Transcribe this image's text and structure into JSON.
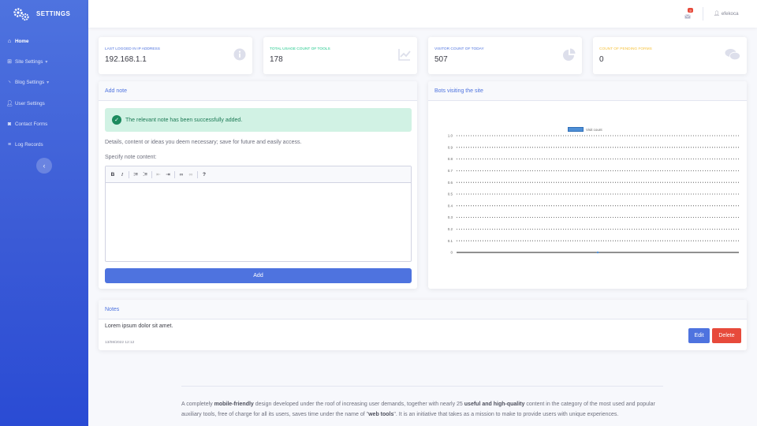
{
  "brand": {
    "title": "SETTINGS"
  },
  "sidebar": {
    "items": [
      {
        "label": "Home",
        "icon": "home-icon",
        "active": true
      },
      {
        "label": "Site Settings",
        "icon": "sitemap-icon",
        "caret": true
      },
      {
        "label": "Blog Settings",
        "icon": "rss-icon",
        "caret": true
      },
      {
        "label": "User Settings",
        "icon": "user-icon"
      },
      {
        "label": "Contact Forms",
        "icon": "comments-icon"
      },
      {
        "label": "Log Records",
        "icon": "database-icon"
      }
    ],
    "toggle_icon": "chevron-left-icon"
  },
  "topbar": {
    "notification_count": "9",
    "username": "efekoca"
  },
  "stats": [
    {
      "label": "LAST LOGGED IN IP ADDRESS",
      "value": "192.168.1.1",
      "icon": "info-circle-icon",
      "color": "#4e73df"
    },
    {
      "label": "TOTAL USAGE COUNT OF TOOLS",
      "value": "178",
      "icon": "chart-line-icon",
      "color": "#1cc88a"
    },
    {
      "label": "VISITOR COUNT OF TODAY",
      "value": "507",
      "icon": "chart-pie-icon",
      "color": "#4e73df"
    },
    {
      "label": "COUNT OF PENDING FORMS",
      "value": "0",
      "icon": "comments-icon",
      "color": "#f6c23e"
    }
  ],
  "add_note": {
    "title": "Add note",
    "alert": "The relevant note has been successfully added.",
    "description": "Details, content or ideas you deem necessary; save for future and easily access.",
    "field_label": "Specify note content:",
    "toolbar": [
      "B",
      "I",
      "ol",
      "ul",
      "outdent",
      "indent",
      "link",
      "unlink",
      "?"
    ],
    "button": "Add"
  },
  "bots": {
    "title": "Bots visiting the site",
    "chart_data": {
      "type": "line",
      "series": [
        {
          "name": "Visit count",
          "values": [
            0
          ]
        }
      ],
      "yticks": [
        "1.0",
        "0.9",
        "0.8",
        "0.7",
        "0.6",
        "0.5",
        "0.4",
        "0.3",
        "0.2",
        "0.1",
        "0"
      ],
      "ylim": [
        0,
        1
      ],
      "grid": true,
      "legend": "top"
    }
  },
  "notes": {
    "title": "Notes",
    "items": [
      {
        "text": "Lorem ipsum dolor sit amet.",
        "date": "13/08/2022 12:12"
      }
    ],
    "edit_label": "Edit",
    "delete_label": "Delete"
  },
  "footer": {
    "p1": "A completely ",
    "b1": "mobile-friendly",
    "p2": " design developed under the roof of increasing user demands, together with nearly 25 ",
    "b2": "useful and high-quality",
    "p3": " content in the category of the most used and popular auxiliary tools, free of charge for all its users, saves time under the name of \"",
    "b3": "web tools",
    "p4": "\". It is an initiative that takes as a mission to make to provide users with unique experiences."
  }
}
